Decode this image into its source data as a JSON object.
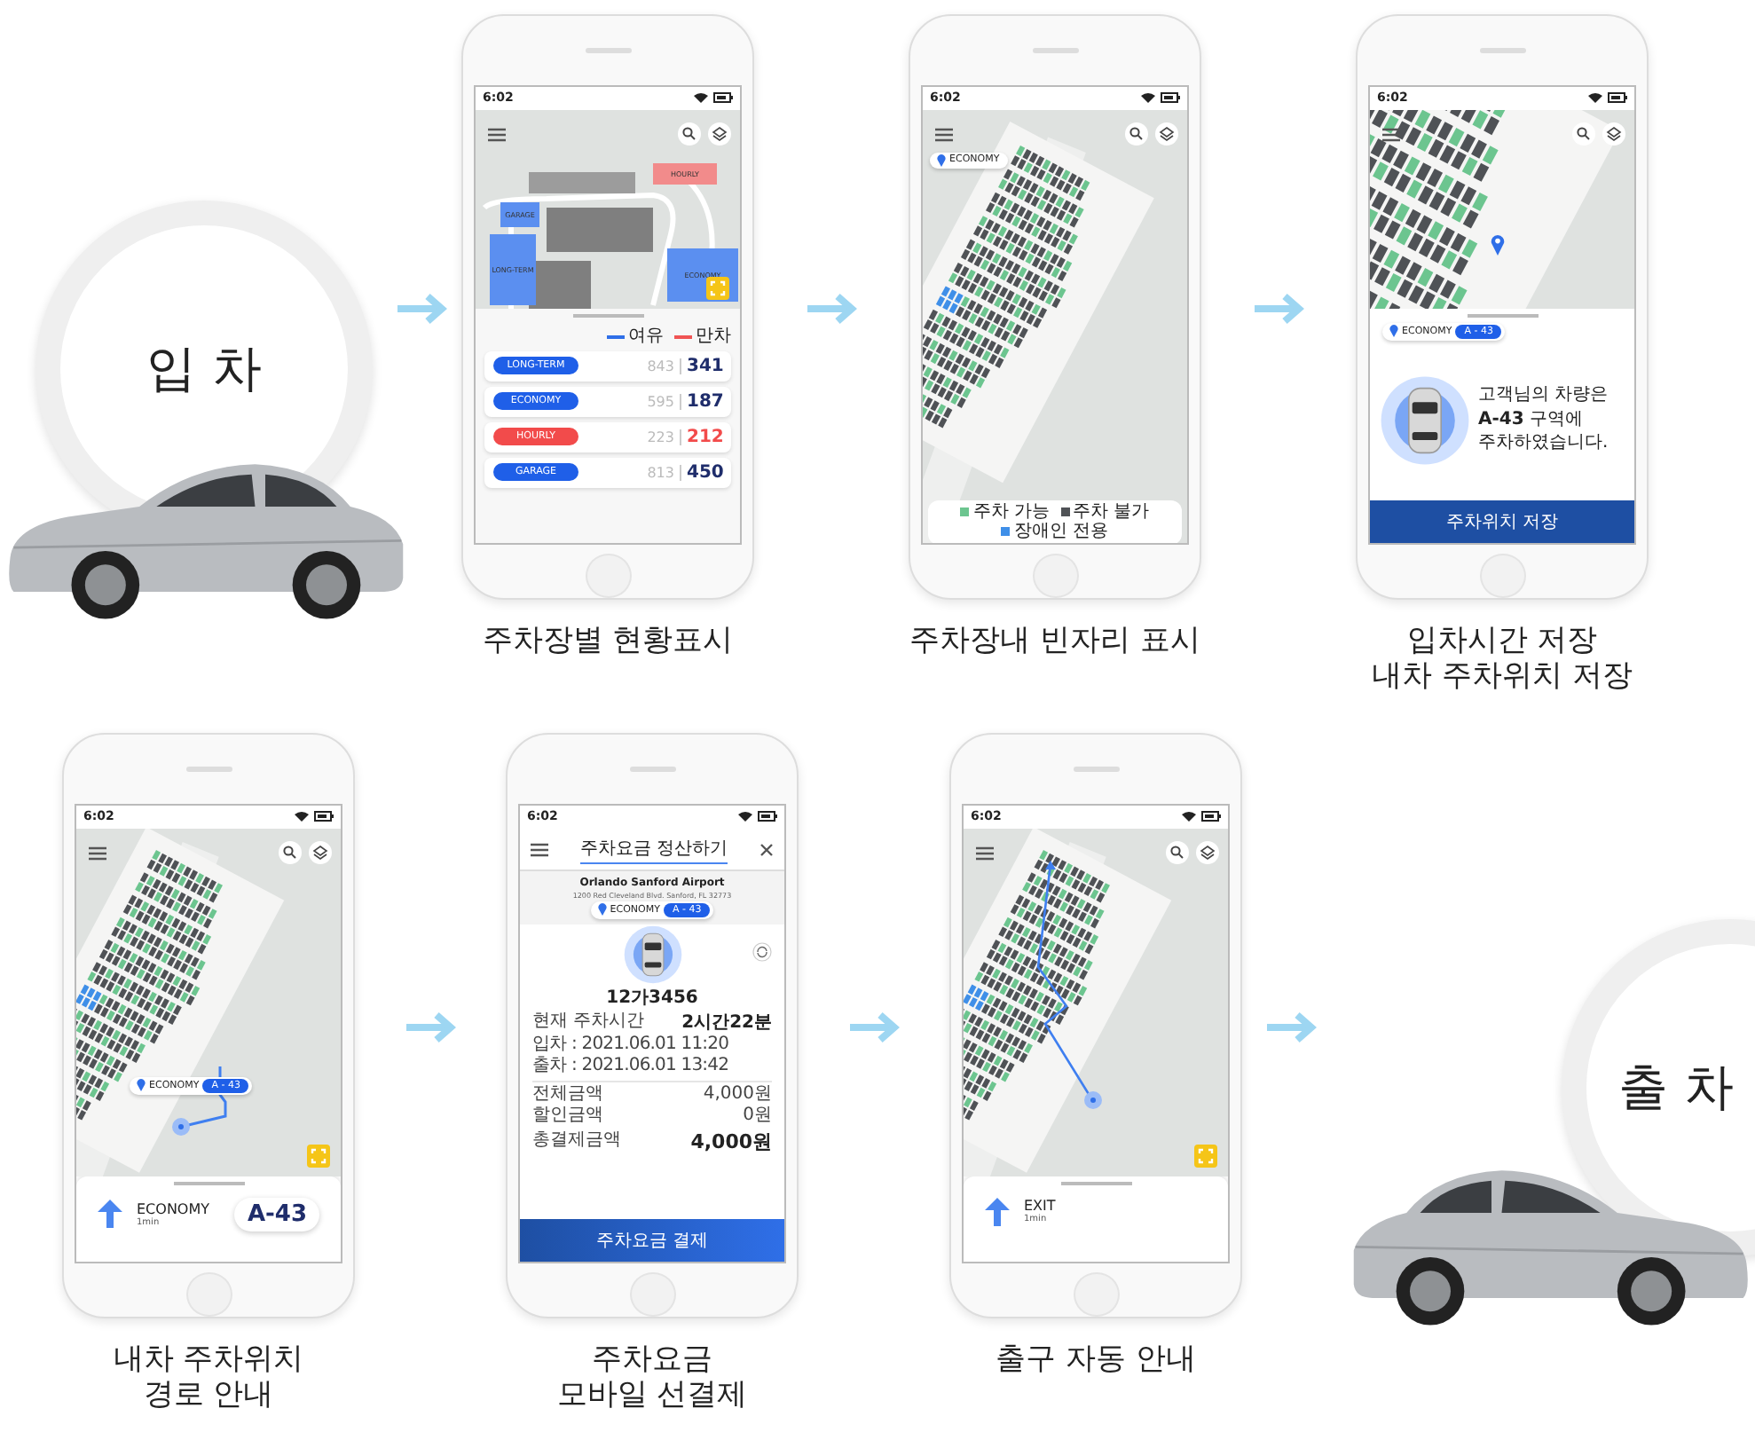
{
  "entry": {
    "label": "입 차"
  },
  "exit": {
    "label": "출 차"
  },
  "screens": [
    {
      "kind": "lot-status",
      "time": "6:02",
      "caption": [
        "주차장별 현황표시"
      ],
      "map_labels": [
        {
          "label": "HOURLY",
          "color": "#f28b8b"
        },
        {
          "label": "GARAGE",
          "color": "#5b8ff0"
        },
        {
          "label": "LONG-TERM",
          "color": "#5b8ff0"
        },
        {
          "label": "ECONOMY",
          "color": "#5b8ff0"
        }
      ],
      "legend": [
        {
          "label": "여유",
          "color": "#2f6fe8"
        },
        {
          "label": "만차",
          "color": "#f05454"
        }
      ],
      "lots": [
        {
          "name": "LONG-TERM",
          "color": "#1f5fe8",
          "total": "843",
          "available": "341",
          "full": false
        },
        {
          "name": "ECONOMY",
          "color": "#1f5fe8",
          "total": "595",
          "available": "187",
          "full": false
        },
        {
          "name": "HOURLY",
          "color": "#f24b4b",
          "total": "223",
          "available": "212",
          "full": true
        },
        {
          "name": "GARAGE",
          "color": "#1f5fe8",
          "total": "813",
          "available": "450",
          "full": false
        }
      ]
    },
    {
      "kind": "vacancy",
      "time": "6:02",
      "caption": [
        "주차장내 빈자리 표시"
      ],
      "zone": "ECONOMY",
      "legend": [
        {
          "label": "주차 가능",
          "color": "#6cc58f"
        },
        {
          "label": "주차 불가",
          "color": "#4f5256"
        },
        {
          "label": "장애인 전용",
          "color": "#3f8fe8"
        }
      ]
    },
    {
      "kind": "saved",
      "time": "6:02",
      "caption": [
        "입차시간 저장",
        "내차 주차위치 저장"
      ],
      "zone": "ECONOMY",
      "spot": "A - 43",
      "message": [
        "고객님의 차량은",
        "**A-43** 구역에",
        "주차하였습니다."
      ],
      "button": "주차위치 저장"
    },
    {
      "kind": "route",
      "time": "6:02",
      "caption": [
        "내차 주차위치",
        "경로 안내"
      ],
      "zone": "ECONOMY",
      "spot": "A - 43",
      "nav": {
        "title": "ECONOMY",
        "eta": "1min",
        "badge": "A-43"
      }
    },
    {
      "kind": "payment",
      "time": "6:02",
      "caption": [
        "주차요금",
        "모바일 선결제"
      ],
      "title": "주차요금 정산하기",
      "airport": "Orlando Sanford Airport",
      "address": "1200 Red Cleveland Blvd. Sanford, FL 32773",
      "zone": "ECONOMY",
      "spot": "A - 43",
      "plate": "12가3456",
      "duration_label": "현재 주차시간",
      "entry_time": "입차 : 2021.06.01 11:20",
      "exit_time": "출차 : 2021.06.01 13:42",
      "duration": "2시간22분",
      "charges": [
        {
          "label": "전체금액",
          "value": "4,000원"
        },
        {
          "label": "할인금액",
          "value": "0원"
        }
      ],
      "total_label": "총결제금액",
      "total": "4,000원",
      "button": "주차요금 결제"
    },
    {
      "kind": "exit-route",
      "time": "6:02",
      "caption": [
        "출구 자동 안내"
      ],
      "nav": {
        "title": "EXIT",
        "eta": "1min"
      }
    }
  ]
}
